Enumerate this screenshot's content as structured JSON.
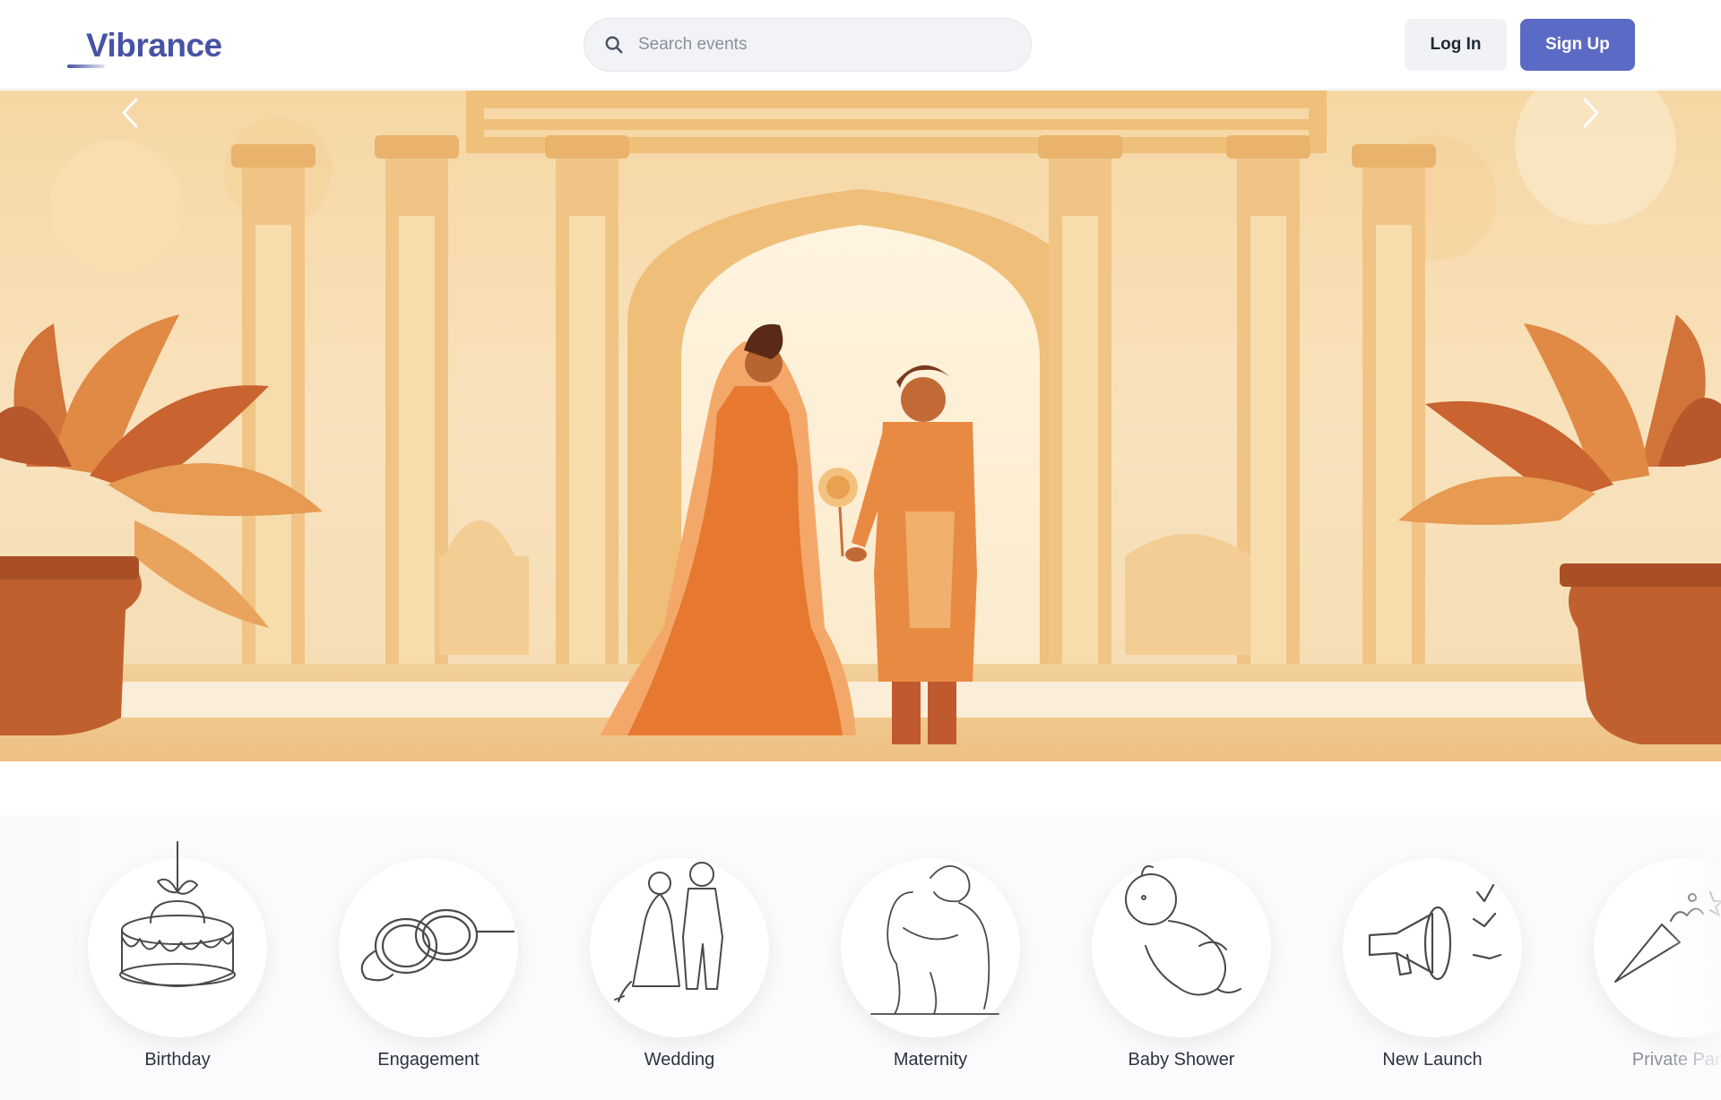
{
  "header": {
    "logo_text": "Vibrance",
    "search": {
      "placeholder": "Search events",
      "value": "",
      "icon": "search-icon"
    },
    "login_label": "Log In",
    "signup_label": "Sign Up",
    "brand_color": "#4753a3",
    "signup_color": "#5b6ac4"
  },
  "hero": {
    "prev_icon": "chevron-left-icon",
    "next_icon": "chevron-right-icon",
    "palette": [
      "#f6d7a4",
      "#eaa15a",
      "#c8612f",
      "#e07c3c",
      "#fff3e0"
    ]
  },
  "categories": [
    {
      "label": "Birthday",
      "icon": "cake-icon"
    },
    {
      "label": "Engagement",
      "icon": "rings-icon"
    },
    {
      "label": "Wedding",
      "icon": "couple-icon"
    },
    {
      "label": "Maternity",
      "icon": "maternity-icon"
    },
    {
      "label": "Baby Shower",
      "icon": "baby-icon"
    },
    {
      "label": "New Launch",
      "icon": "megaphone-icon"
    },
    {
      "label": "Private Party",
      "icon": "party-popper-icon"
    }
  ]
}
